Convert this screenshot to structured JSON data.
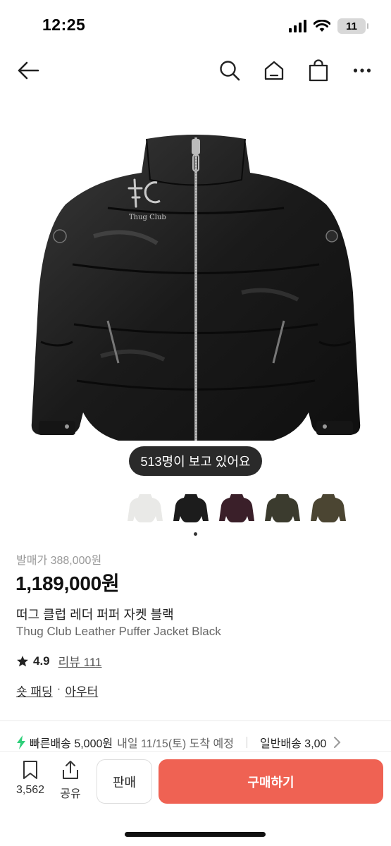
{
  "status_bar": {
    "time": "12:25",
    "battery": "11"
  },
  "product": {
    "viewers_text": "513명이 보고 있어요",
    "release_price": "발매가 388,000원",
    "price": "1,189,000원",
    "name_ko": "떠그 클럽 레더 퍼퍼 자켓 블랙",
    "name_en": "Thug Club Leather Puffer Jacket Black",
    "rating": "4.9",
    "review_label": "리뷰 111",
    "categories": [
      "숏 패딩",
      "아우터"
    ],
    "category_separator": "·",
    "logo_text": "Thug Club"
  },
  "thumbnails": [
    {
      "color": "#e9e9e7"
    },
    {
      "color": "#1c1c1c"
    },
    {
      "color": "#3a1f29"
    },
    {
      "color": "#3b3b2e"
    },
    {
      "color": "#4b4532"
    }
  ],
  "shipping": {
    "fast_label": "빠른배송 5,000원",
    "fast_date": "내일 11/15(토) 도착 예정",
    "normal_label": "일반배송 3,00"
  },
  "bottom_bar": {
    "save_count": "3,562",
    "share_label": "공유",
    "sell_label": "판매",
    "buy_label": "구매하기"
  },
  "colors": {
    "accent": "#ef6253",
    "bolt": "#2fcf7a"
  },
  "icons": [
    "back-arrow-icon",
    "search-icon",
    "home-icon",
    "shopping-bag-icon",
    "more-icon",
    "star-icon",
    "bolt-icon",
    "chevron-right-icon",
    "bookmark-icon",
    "share-icon"
  ]
}
